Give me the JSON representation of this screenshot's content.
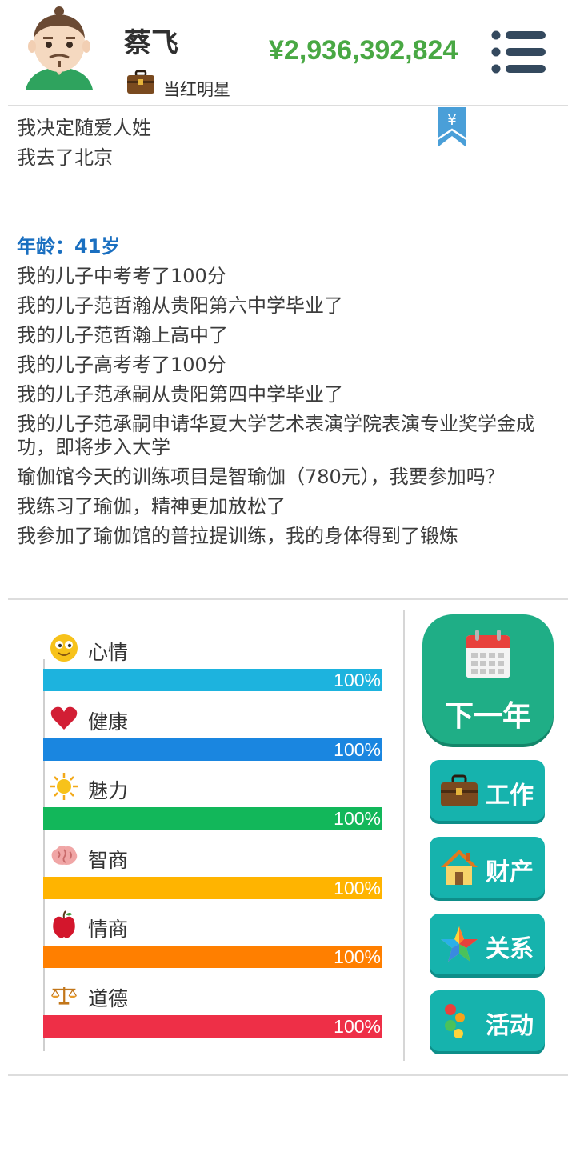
{
  "header": {
    "name": "蔡飞",
    "job": "当红明星",
    "money": "¥2,936,392,824"
  },
  "log": {
    "lines_a": [
      "我决定随爱人姓",
      "我去了北京"
    ],
    "age": "年龄：41岁",
    "lines_b": [
      "我的儿子中考考了100分",
      "我的儿子范哲瀚从贵阳第六中学毕业了",
      "我的儿子范哲瀚上高中了",
      "我的儿子高考考了100分",
      "我的儿子范承嗣从贵阳第四中学毕业了",
      "我的儿子范承嗣申请华夏大学艺术表演学院表演专业奖学金成功，即将步入大学",
      "瑜伽馆今天的训练项目是智瑜伽（780元），我要参加吗？",
      "我练习了瑜伽，精神更加放松了",
      "我参加了瑜伽馆的普拉提训练，我的身体得到了锻炼"
    ]
  },
  "stats": [
    {
      "label": "心情",
      "value": "100%",
      "level": 1.0,
      "color": "#1db3de",
      "icon": "smiley-icon"
    },
    {
      "label": "健康",
      "value": "100%",
      "level": 1.0,
      "color": "#1a86e0",
      "icon": "heart-icon"
    },
    {
      "label": "魅力",
      "value": "100%",
      "level": 1.0,
      "color": "#12b75a",
      "icon": "sun-icon"
    },
    {
      "label": "智商",
      "value": "100%",
      "level": 1.0,
      "color": "#ffb400",
      "icon": "brain-icon"
    },
    {
      "label": "情商",
      "value": "100%",
      "level": 1.0,
      "color": "#ff7f00",
      "icon": "apple-icon"
    },
    {
      "label": "道德",
      "value": "100%",
      "level": 1.0,
      "color": "#ee2f47",
      "icon": "scales-icon"
    }
  ],
  "actions": {
    "next_year": "下一年",
    "work": "工作",
    "assets": "财产",
    "relations": "关系",
    "activities": "活动"
  },
  "colors": {
    "money": "#49a844",
    "age": "#1a6fc0",
    "next_button": "#1fae86",
    "side_button": "#16b3ad"
  }
}
